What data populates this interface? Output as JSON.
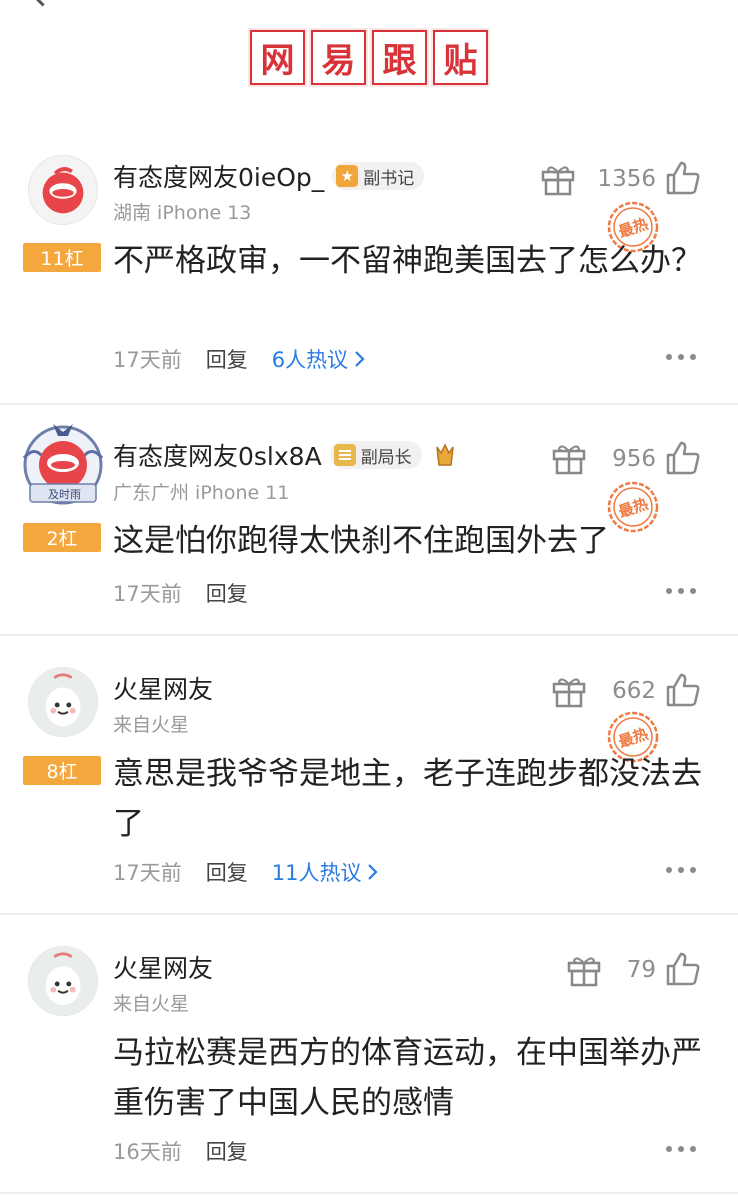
{
  "header": {
    "title_chars": [
      "网",
      "易",
      "跟",
      "贴"
    ]
  },
  "comments": [
    {
      "username": "有态度网友0ieOp_",
      "rank": "副书记",
      "location": "湖南  iPhone 13",
      "likes": "1356",
      "hot_stamp": "最热",
      "floor": "11杠",
      "content": "不严格政审，一不留神跑美国去了怎么办？",
      "time": "17天前",
      "reply": "回复",
      "hot_discuss": "6人热议"
    },
    {
      "username": "有态度网友0slx8A",
      "rank": "副局长",
      "location": "广东广州  iPhone 11",
      "avatar_frame_text": "及时雨",
      "likes": "956",
      "hot_stamp": "最热",
      "floor": "2杠",
      "content": "这是怕你跑得太快刹不住跑国外去了",
      "time": "17天前",
      "reply": "回复"
    },
    {
      "username": "火星网友",
      "location": "来自火星",
      "likes": "662",
      "hot_stamp": "最热",
      "floor": "8杠",
      "content": "意思是我爷爷是地主，老子连跑步都没法去了",
      "time": "17天前",
      "reply": "回复",
      "hot_discuss": "11人热议"
    },
    {
      "username": "火星网友",
      "location": "来自火星",
      "likes": "79",
      "content": "马拉松赛是西方的体育运动，在中国举办严重伤害了中国人民的感情",
      "time": "16天前",
      "reply": "回复"
    }
  ],
  "colors": {
    "brand_red": "#d9333a",
    "floor_orange": "#f4a73d",
    "link_blue": "#2a7be0"
  },
  "icons": [
    "gift-icon",
    "thumbs-up-icon",
    "more-icon",
    "chevron-right-icon",
    "crown-icon",
    "star-icon"
  ]
}
